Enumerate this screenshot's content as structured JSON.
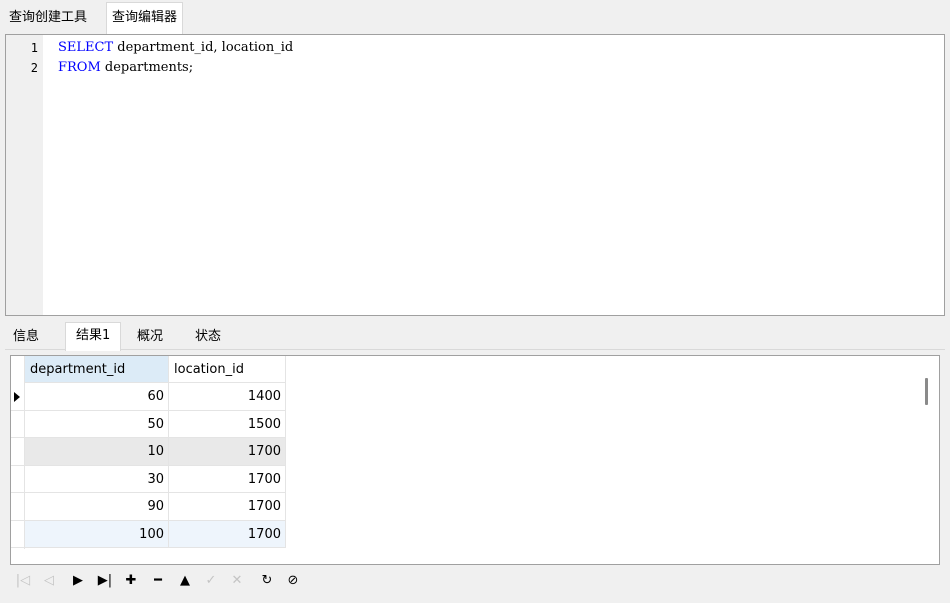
{
  "top_tabs": [
    {
      "label": "查询创建工具",
      "active": false
    },
    {
      "label": "查询编辑器",
      "active": true
    }
  ],
  "editor": {
    "lines": [
      {
        "no": "1",
        "keyword": "SELECT",
        "rest": " department_id, location_id"
      },
      {
        "no": "2",
        "keyword": "FROM",
        "rest": " departments;"
      }
    ]
  },
  "result_tabs": [
    {
      "label": "信息"
    },
    {
      "label": "结果1"
    },
    {
      "label": "概况"
    },
    {
      "label": "状态"
    }
  ],
  "grid": {
    "columns": [
      "department_id",
      "location_id"
    ],
    "rows": [
      [
        "60",
        "1400"
      ],
      [
        "50",
        "1500"
      ],
      [
        "10",
        "1700"
      ],
      [
        "30",
        "1700"
      ],
      [
        "90",
        "1700"
      ],
      [
        "100",
        "1700"
      ]
    ]
  },
  "nav": {
    "first": "|◁",
    "prev": "◁",
    "next": "▶",
    "last": "▶|",
    "add": "✚",
    "delete": "━",
    "apply": "▲",
    "commit": "✓",
    "discard": "✕",
    "refresh": "↻",
    "stop": "⊘"
  },
  "colors": {
    "keyword": "#0000ff",
    "header_selected": "#dcebf7",
    "row_highlight": "#e9e9e9"
  }
}
